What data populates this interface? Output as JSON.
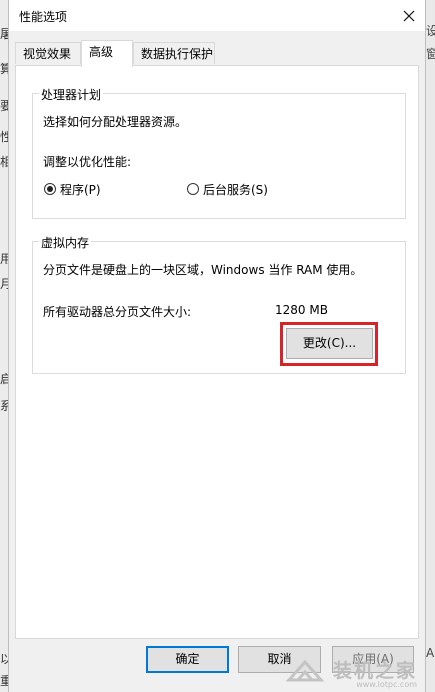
{
  "background": {
    "left_fragments": [
      "屠",
      "算",
      "要",
      "性",
      "相",
      "用",
      "月",
      "启",
      "系",
      "以",
      "重"
    ],
    "right_fragments": [
      "设",
      "窗",
      "A"
    ]
  },
  "dialog": {
    "title": "性能选项",
    "close_icon": "close-icon",
    "tabs": [
      {
        "label": "视觉效果",
        "active": false
      },
      {
        "label": "高级",
        "active": true
      },
      {
        "label": "数据执行保护",
        "active": false
      }
    ],
    "cpu_group": {
      "legend": "处理器计划",
      "description": "选择如何分配处理器资源。",
      "optimize_label": "调整以优化性能:",
      "options": [
        {
          "label": "程序(P)",
          "checked": true
        },
        {
          "label": "后台服务(S)",
          "checked": false
        }
      ]
    },
    "vm_group": {
      "legend": "虚拟内存",
      "description": "分页文件是硬盘上的一块区域，Windows 当作 RAM 使用。",
      "total_label": "所有驱动器总分页文件大小:",
      "total_value": "1280 MB",
      "change_button": "更改(C)..."
    },
    "highlight_color": "#d9232a",
    "buttons": {
      "ok": "确定",
      "cancel": "取消",
      "apply": "应用(A)"
    }
  },
  "watermark": {
    "logo": "装机之家",
    "url": "www.lotpc.com"
  }
}
